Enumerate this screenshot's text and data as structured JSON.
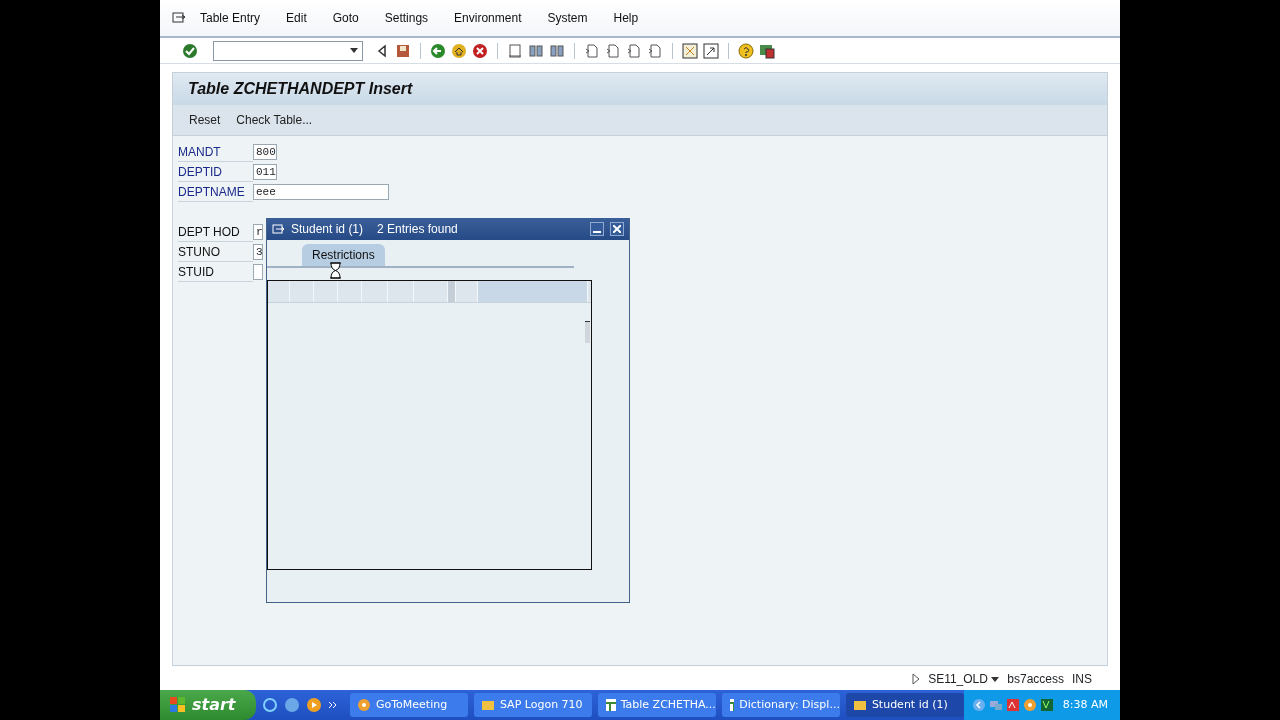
{
  "menu": [
    {
      "label": "Table Entry"
    },
    {
      "label": "Edit"
    },
    {
      "label": "Goto"
    },
    {
      "label": "Settings"
    },
    {
      "label": "Environment"
    },
    {
      "label": "System"
    },
    {
      "label": "Help"
    }
  ],
  "title": "Table ZCHETHANDEPT Insert",
  "actions": [
    "Reset",
    "Check Table..."
  ],
  "fields": [
    {
      "label": "MANDT",
      "value": "800",
      "kind": "short",
      "key": true
    },
    {
      "label": "DEPTID",
      "value": "011",
      "kind": "short",
      "key": true
    },
    {
      "label": "DEPTNAME",
      "value": "eee",
      "kind": "long",
      "key": true
    },
    {
      "label": "DEPT HOD",
      "value": "r",
      "kind": "covered",
      "key": false
    },
    {
      "label": "STUNO",
      "value": "3",
      "kind": "covered",
      "key": false
    },
    {
      "label": "STUID",
      "kind": "covered",
      "key": false
    }
  ],
  "popup": {
    "title": "Student id (1)",
    "subtitle": "2 Entries found",
    "tabs": [
      {
        "label": "Restrictions",
        "selected": true
      }
    ]
  },
  "status_bar": {
    "transaction": "SE11_OLD",
    "server": "bs7access",
    "mode": "INS"
  },
  "taskbar": {
    "start": "start",
    "tasks": [
      {
        "label": "GoToMeeting",
        "selected": false,
        "kind": "meeting"
      },
      {
        "label": "SAP Logon 710",
        "selected": false,
        "kind": "folder"
      },
      {
        "label": "Table ZCHETHA...",
        "selected": false,
        "kind": "table"
      },
      {
        "label": "Dictionary: Displ...",
        "selected": false,
        "kind": "table"
      },
      {
        "label": "Student id (1)",
        "selected": true,
        "kind": "folder"
      }
    ],
    "clock": "8:38 AM"
  }
}
